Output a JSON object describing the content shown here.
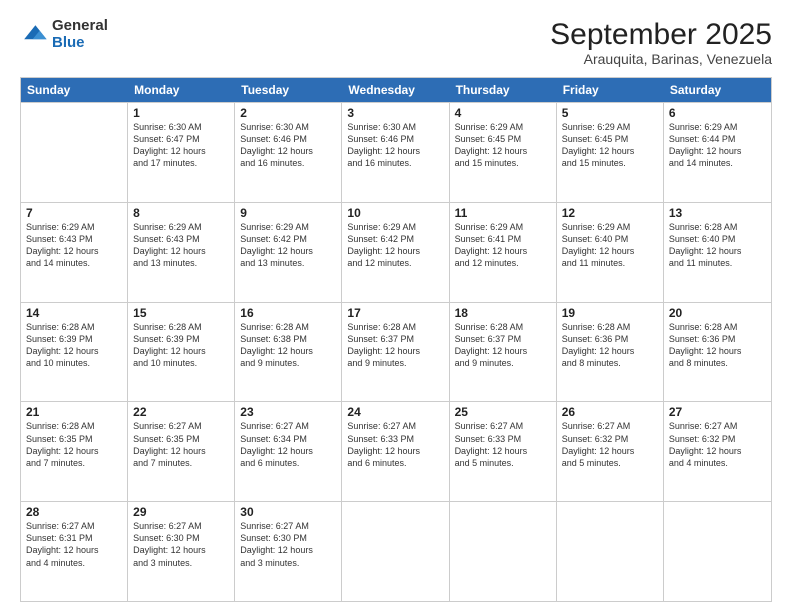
{
  "logo": {
    "general": "General",
    "blue": "Blue"
  },
  "header": {
    "month": "September 2025",
    "location": "Arauquita, Barinas, Venezuela"
  },
  "days": [
    "Sunday",
    "Monday",
    "Tuesday",
    "Wednesday",
    "Thursday",
    "Friday",
    "Saturday"
  ],
  "rows": [
    [
      {
        "num": "",
        "info": ""
      },
      {
        "num": "1",
        "info": "Sunrise: 6:30 AM\nSunset: 6:47 PM\nDaylight: 12 hours\nand 17 minutes."
      },
      {
        "num": "2",
        "info": "Sunrise: 6:30 AM\nSunset: 6:46 PM\nDaylight: 12 hours\nand 16 minutes."
      },
      {
        "num": "3",
        "info": "Sunrise: 6:30 AM\nSunset: 6:46 PM\nDaylight: 12 hours\nand 16 minutes."
      },
      {
        "num": "4",
        "info": "Sunrise: 6:29 AM\nSunset: 6:45 PM\nDaylight: 12 hours\nand 15 minutes."
      },
      {
        "num": "5",
        "info": "Sunrise: 6:29 AM\nSunset: 6:45 PM\nDaylight: 12 hours\nand 15 minutes."
      },
      {
        "num": "6",
        "info": "Sunrise: 6:29 AM\nSunset: 6:44 PM\nDaylight: 12 hours\nand 14 minutes."
      }
    ],
    [
      {
        "num": "7",
        "info": "Sunrise: 6:29 AM\nSunset: 6:43 PM\nDaylight: 12 hours\nand 14 minutes."
      },
      {
        "num": "8",
        "info": "Sunrise: 6:29 AM\nSunset: 6:43 PM\nDaylight: 12 hours\nand 13 minutes."
      },
      {
        "num": "9",
        "info": "Sunrise: 6:29 AM\nSunset: 6:42 PM\nDaylight: 12 hours\nand 13 minutes."
      },
      {
        "num": "10",
        "info": "Sunrise: 6:29 AM\nSunset: 6:42 PM\nDaylight: 12 hours\nand 12 minutes."
      },
      {
        "num": "11",
        "info": "Sunrise: 6:29 AM\nSunset: 6:41 PM\nDaylight: 12 hours\nand 12 minutes."
      },
      {
        "num": "12",
        "info": "Sunrise: 6:29 AM\nSunset: 6:40 PM\nDaylight: 12 hours\nand 11 minutes."
      },
      {
        "num": "13",
        "info": "Sunrise: 6:28 AM\nSunset: 6:40 PM\nDaylight: 12 hours\nand 11 minutes."
      }
    ],
    [
      {
        "num": "14",
        "info": "Sunrise: 6:28 AM\nSunset: 6:39 PM\nDaylight: 12 hours\nand 10 minutes."
      },
      {
        "num": "15",
        "info": "Sunrise: 6:28 AM\nSunset: 6:39 PM\nDaylight: 12 hours\nand 10 minutes."
      },
      {
        "num": "16",
        "info": "Sunrise: 6:28 AM\nSunset: 6:38 PM\nDaylight: 12 hours\nand 9 minutes."
      },
      {
        "num": "17",
        "info": "Sunrise: 6:28 AM\nSunset: 6:37 PM\nDaylight: 12 hours\nand 9 minutes."
      },
      {
        "num": "18",
        "info": "Sunrise: 6:28 AM\nSunset: 6:37 PM\nDaylight: 12 hours\nand 9 minutes."
      },
      {
        "num": "19",
        "info": "Sunrise: 6:28 AM\nSunset: 6:36 PM\nDaylight: 12 hours\nand 8 minutes."
      },
      {
        "num": "20",
        "info": "Sunrise: 6:28 AM\nSunset: 6:36 PM\nDaylight: 12 hours\nand 8 minutes."
      }
    ],
    [
      {
        "num": "21",
        "info": "Sunrise: 6:28 AM\nSunset: 6:35 PM\nDaylight: 12 hours\nand 7 minutes."
      },
      {
        "num": "22",
        "info": "Sunrise: 6:27 AM\nSunset: 6:35 PM\nDaylight: 12 hours\nand 7 minutes."
      },
      {
        "num": "23",
        "info": "Sunrise: 6:27 AM\nSunset: 6:34 PM\nDaylight: 12 hours\nand 6 minutes."
      },
      {
        "num": "24",
        "info": "Sunrise: 6:27 AM\nSunset: 6:33 PM\nDaylight: 12 hours\nand 6 minutes."
      },
      {
        "num": "25",
        "info": "Sunrise: 6:27 AM\nSunset: 6:33 PM\nDaylight: 12 hours\nand 5 minutes."
      },
      {
        "num": "26",
        "info": "Sunrise: 6:27 AM\nSunset: 6:32 PM\nDaylight: 12 hours\nand 5 minutes."
      },
      {
        "num": "27",
        "info": "Sunrise: 6:27 AM\nSunset: 6:32 PM\nDaylight: 12 hours\nand 4 minutes."
      }
    ],
    [
      {
        "num": "28",
        "info": "Sunrise: 6:27 AM\nSunset: 6:31 PM\nDaylight: 12 hours\nand 4 minutes."
      },
      {
        "num": "29",
        "info": "Sunrise: 6:27 AM\nSunset: 6:30 PM\nDaylight: 12 hours\nand 3 minutes."
      },
      {
        "num": "30",
        "info": "Sunrise: 6:27 AM\nSunset: 6:30 PM\nDaylight: 12 hours\nand 3 minutes."
      },
      {
        "num": "",
        "info": ""
      },
      {
        "num": "",
        "info": ""
      },
      {
        "num": "",
        "info": ""
      },
      {
        "num": "",
        "info": ""
      }
    ]
  ]
}
